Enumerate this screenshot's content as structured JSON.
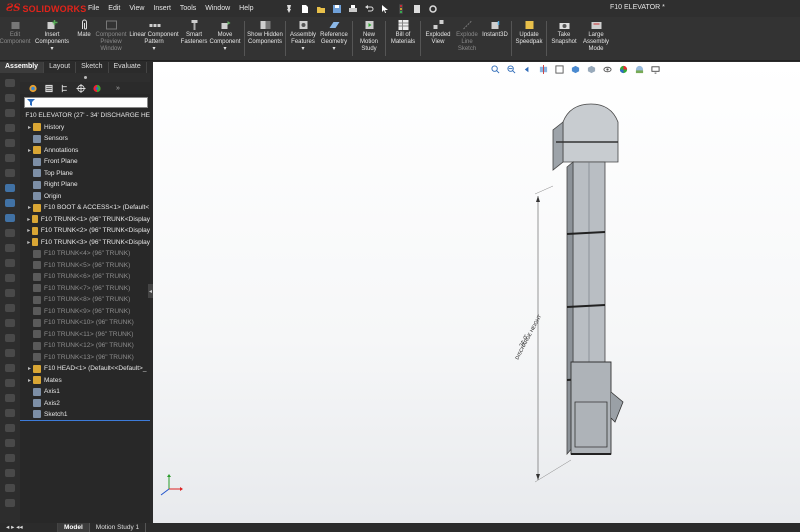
{
  "app": {
    "brand": "SOLIDWORKS",
    "document_title": "F10 ELEVATOR *"
  },
  "menu": [
    "File",
    "Edit",
    "View",
    "Insert",
    "Tools",
    "Window",
    "Help"
  ],
  "commands": [
    {
      "label": "Edit Component",
      "disabled": true
    },
    {
      "label": "Insert Components",
      "disabled": false
    },
    {
      "label": "Mate",
      "disabled": false
    },
    {
      "label": "Component Preview Window",
      "disabled": true
    },
    {
      "label": "Linear Component Pattern",
      "disabled": false
    },
    {
      "label": "Smart Fasteners",
      "disabled": false
    },
    {
      "label": "Move Component",
      "disabled": false
    },
    {
      "label": "Show Hidden Components",
      "disabled": false
    },
    {
      "label": "Assembly Features",
      "disabled": false
    },
    {
      "label": "Reference Geometry",
      "disabled": false
    },
    {
      "label": "New Motion Study",
      "disabled": false
    },
    {
      "label": "Bill of Materials",
      "disabled": false
    },
    {
      "label": "Exploded View",
      "disabled": false
    },
    {
      "label": "Explode Line Sketch",
      "disabled": true
    },
    {
      "label": "Instant3D",
      "disabled": false
    },
    {
      "label": "Update Speedpak",
      "disabled": false
    },
    {
      "label": "Take Snapshot",
      "disabled": false
    },
    {
      "label": "Large Assembly Mode",
      "disabled": false
    }
  ],
  "tabs": [
    "Assembly",
    "Layout",
    "Sketch",
    "Evaluate"
  ],
  "tree": {
    "filter_placeholder": "",
    "root": "F10 ELEVATOR  (27' - 34' DISCHARGE HE",
    "items": [
      {
        "label": "History",
        "arrow": "▸",
        "suppressed": false
      },
      {
        "label": "Sensors",
        "arrow": "",
        "suppressed": false
      },
      {
        "label": "Annotations",
        "arrow": "▸",
        "suppressed": false
      },
      {
        "label": "Front Plane",
        "arrow": "",
        "suppressed": false
      },
      {
        "label": "Top Plane",
        "arrow": "",
        "suppressed": false
      },
      {
        "label": "Right Plane",
        "arrow": "",
        "suppressed": false
      },
      {
        "label": "Origin",
        "arrow": "",
        "suppressed": false
      },
      {
        "label": "F10 BOOT & ACCESS<1> (Default<",
        "arrow": "▸",
        "suppressed": false
      },
      {
        "label": "F10 TRUNK<1> (96\" TRUNK<Display",
        "arrow": "▸",
        "suppressed": false
      },
      {
        "label": "F10 TRUNK<2> (96\" TRUNK<Display",
        "arrow": "▸",
        "suppressed": false
      },
      {
        "label": "F10 TRUNK<3> (96\" TRUNK<Display",
        "arrow": "▸",
        "suppressed": false
      },
      {
        "label": "F10 TRUNK<4> (96\" TRUNK)",
        "arrow": "",
        "suppressed": true
      },
      {
        "label": "F10 TRUNK<5> (96\" TRUNK)",
        "arrow": "",
        "suppressed": true
      },
      {
        "label": "F10 TRUNK<6> (96\" TRUNK)",
        "arrow": "",
        "suppressed": true
      },
      {
        "label": "F10 TRUNK<7> (96\" TRUNK)",
        "arrow": "",
        "suppressed": true
      },
      {
        "label": "F10 TRUNK<8> (96\" TRUNK)",
        "arrow": "",
        "suppressed": true
      },
      {
        "label": "F10 TRUNK<9> (96\" TRUNK)",
        "arrow": "",
        "suppressed": true
      },
      {
        "label": "F10 TRUNK<10> (96\" TRUNK)",
        "arrow": "",
        "suppressed": true
      },
      {
        "label": "F10 TRUNK<11> (96\" TRUNK)",
        "arrow": "",
        "suppressed": true
      },
      {
        "label": "F10 TRUNK<12> (96\" TRUNK)",
        "arrow": "",
        "suppressed": true
      },
      {
        "label": "F10 TRUNK<13> (96\" TRUNK)",
        "arrow": "",
        "suppressed": true
      },
      {
        "label": "F10 HEAD<1> (Default<<Default>_",
        "arrow": "▸",
        "suppressed": false
      },
      {
        "label": "Mates",
        "arrow": "▸",
        "suppressed": false
      },
      {
        "label": "Axis1",
        "arrow": "",
        "suppressed": false
      },
      {
        "label": "Axis2",
        "arrow": "",
        "suppressed": false
      },
      {
        "label": "Sketch1",
        "arrow": "",
        "suppressed": false
      }
    ]
  },
  "drawing": {
    "dimension_line1": "34'-0\"",
    "dimension_line2": "DISCHARGE HEIGHT"
  },
  "bottom_tabs": [
    "Model",
    "Motion Study 1"
  ],
  "colors": {
    "brand_red": "#e2231a",
    "selection_blue": "#3d7bd9"
  }
}
